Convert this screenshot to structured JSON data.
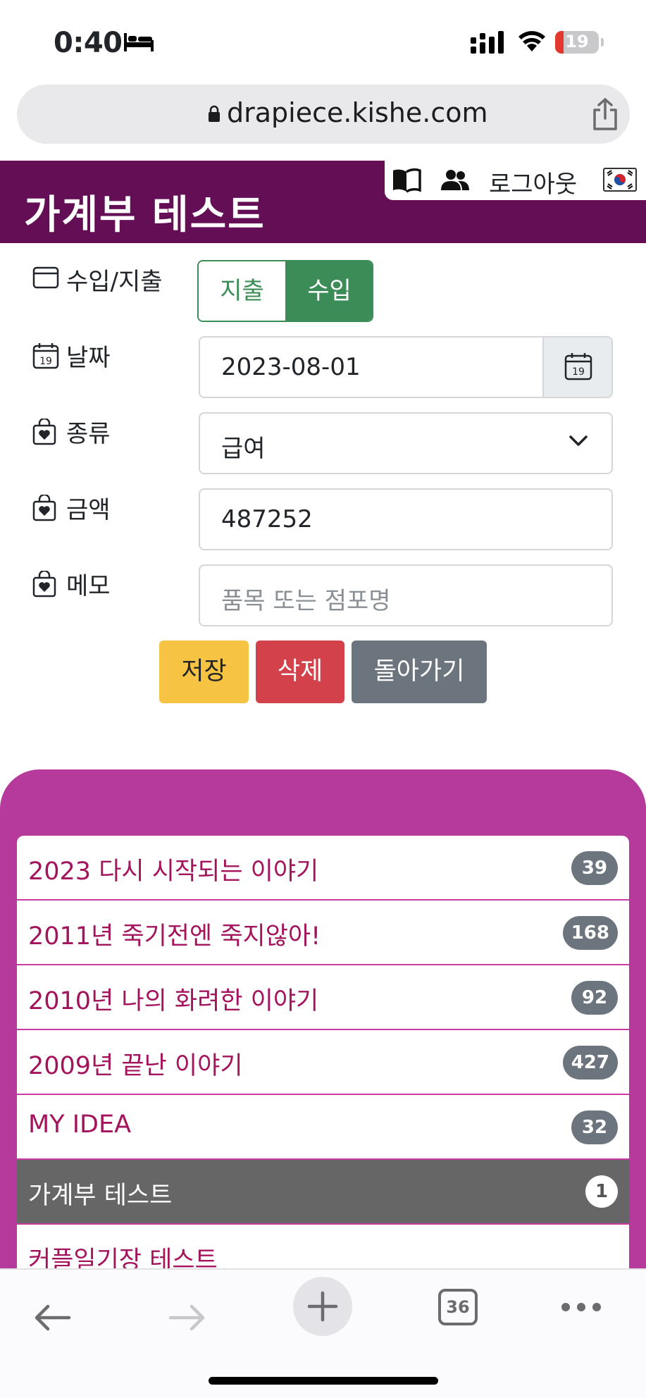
{
  "status_bar": {
    "time": "0:40",
    "battery": "19",
    "icons": [
      "bed-icon",
      "signal-icon",
      "wifi-icon",
      "battery-icon"
    ]
  },
  "browser": {
    "url": "drapiece.kishe.com",
    "tab_count": "36",
    "icons": [
      "lock-icon",
      "share-icon",
      "back-arrow-icon",
      "forward-arrow-icon",
      "plus-icon",
      "more-icon"
    ]
  },
  "header": {
    "title": "가계부 테스트",
    "logout": "로그아웃",
    "icons": [
      "book-icon",
      "people-icon",
      "korea-flag-icon"
    ]
  },
  "form": {
    "type_label": "수입/지출",
    "type_options": [
      "지출",
      "수입"
    ],
    "type_selected": "수입",
    "date_label": "날짜",
    "date_value": "2023-08-01",
    "category_label": "종류",
    "category_value": "급여",
    "amount_label": "금액",
    "amount_value": "487252",
    "memo_label": "메모",
    "memo_placeholder": "품목 또는 점포명",
    "save": "저장",
    "delete": "삭제",
    "back": "돌아가기"
  },
  "categories": [
    {
      "name": "2023 다시 시작되는 이야기",
      "count": "39"
    },
    {
      "name": "2011년 죽기전엔 죽지않아!",
      "count": "168"
    },
    {
      "name": "2010년 나의 화려한 이야기",
      "count": "92"
    },
    {
      "name": "2009년 끝난 이야기",
      "count": "427"
    },
    {
      "name": "MY IDEA",
      "count": "32"
    },
    {
      "name": "가계부 테스트",
      "count": "1",
      "active": true
    },
    {
      "name": "커플일기장 테스트",
      "count": ""
    }
  ],
  "colors": {
    "header_bg": "#640f55",
    "panel_bg": "#b63a9c",
    "income_green": "#3c8c57",
    "save_yellow": "#f6c342",
    "delete_red": "#d3424a",
    "back_gray": "#6c757d"
  }
}
